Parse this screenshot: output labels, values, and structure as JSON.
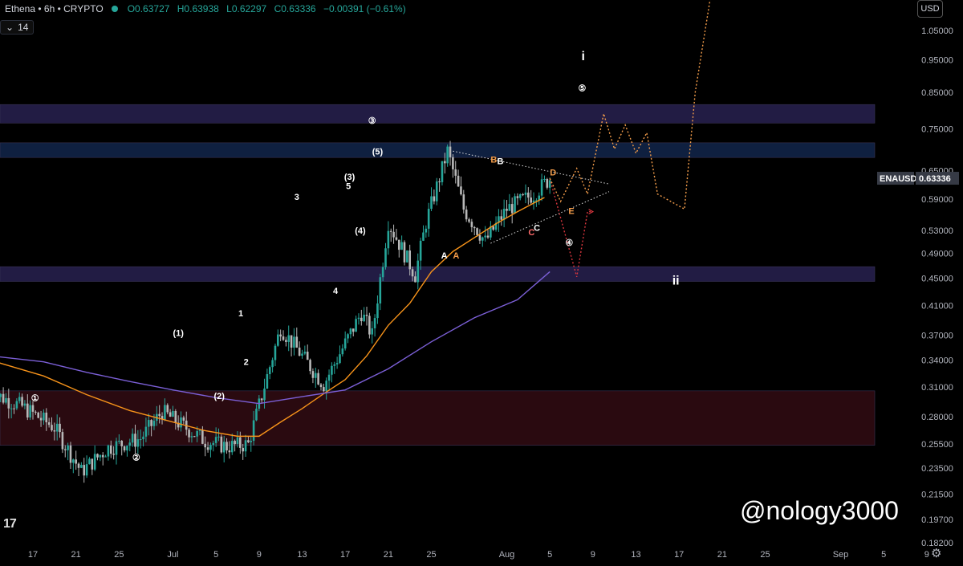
{
  "header": {
    "symbol": "Ethena • 6h • CRYPTO",
    "open": "O0.63727",
    "high": "H0.63938",
    "low": "L0.62297",
    "close": "C0.63336",
    "change": "−0.00391 (−0.61%)"
  },
  "indicator_toggle": "14",
  "currency": "USD",
  "watermark": "@nology3000",
  "tv_logo": "17",
  "settings_icon": "gear-icon",
  "price_badge": {
    "symbol": "ENAUSD",
    "value": "0.63336"
  },
  "colors": {
    "background": "#000000",
    "up_candle": "#26a69a",
    "down_candle": "#b8b8b8",
    "ma_short": "#f7931a",
    "ma_long": "#7b5fd6",
    "zone_purple": "#221c44",
    "zone_blue": "#0f2040",
    "zone_red": "#2a0a10",
    "projection_red": "#d9363e",
    "projection_orange": "#f39c4a"
  },
  "chart_data": {
    "type": "candlestick",
    "interval": "6h",
    "y_axis": {
      "scale": "log",
      "ticks": [
        1.05,
        0.95,
        0.85,
        0.75,
        0.65,
        0.59,
        0.53,
        0.49,
        0.45,
        0.41,
        0.37,
        0.34,
        0.31,
        0.28,
        0.255,
        0.235,
        0.215,
        0.197,
        0.182
      ],
      "tick_labels": [
        "1.05000",
        "0.95000",
        "0.85000",
        "0.75000",
        "0.65000",
        "0.59000",
        "0.53000",
        "0.49000",
        "0.45000",
        "0.41000",
        "0.37000",
        "0.34000",
        "0.31000",
        "0.28000",
        "0.25500",
        "0.23500",
        "0.21500",
        "0.19700",
        "0.18200"
      ]
    },
    "x_axis": {
      "tick_labels": [
        "17",
        "21",
        "25",
        "Jul",
        "5",
        "9",
        "13",
        "17",
        "21",
        "25",
        "Aug",
        "5",
        "9",
        "13",
        "17",
        "21",
        "25",
        "Sep",
        "5",
        "9"
      ],
      "tick_days": [
        17,
        21,
        25,
        30,
        34,
        38,
        42,
        46,
        50,
        54,
        61,
        65,
        69,
        73,
        77,
        81,
        85,
        92,
        96,
        100
      ],
      "day_reference": "June 1 = day 0"
    },
    "zones": [
      {
        "name": "resistance-purple",
        "from": 0.765,
        "to": 0.815,
        "color": "#221c44"
      },
      {
        "name": "resistance-blue",
        "from": 0.68,
        "to": 0.715,
        "color": "#0f2040"
      },
      {
        "name": "support-purple",
        "from": 0.445,
        "to": 0.468,
        "color": "#221c44"
      },
      {
        "name": "demand-red",
        "from": 0.254,
        "to": 0.306,
        "color": "#2a0a10"
      }
    ],
    "price_path": {
      "x": [
        13,
        16,
        19,
        21.5,
        24,
        27,
        29,
        31,
        33,
        35,
        37,
        40,
        44,
        47.5,
        48.5,
        50,
        52.5,
        53.5,
        55.5,
        57,
        59,
        61,
        63.5,
        65
      ],
      "y": [
        0.305,
        0.29,
        0.27,
        0.232,
        0.252,
        0.26,
        0.285,
        0.271,
        0.258,
        0.253,
        0.255,
        0.38,
        0.313,
        0.4,
        0.37,
        0.545,
        0.455,
        0.545,
        0.695,
        0.57,
        0.51,
        0.57,
        0.6,
        0.633
      ]
    },
    "moving_averages": [
      {
        "name": "ma-short",
        "color": "#f7931a",
        "x": [
          13,
          18,
          22,
          26,
          30,
          33,
          36,
          38,
          40,
          42,
          44,
          46,
          48,
          50,
          52,
          54,
          56,
          58,
          60,
          62,
          64.5
        ],
        "y": [
          0.34,
          0.322,
          0.302,
          0.286,
          0.275,
          0.267,
          0.262,
          0.262,
          0.275,
          0.288,
          0.303,
          0.318,
          0.345,
          0.383,
          0.413,
          0.46,
          0.493,
          0.517,
          0.542,
          0.565,
          0.593
        ]
      },
      {
        "name": "ma-long",
        "color": "#7b5fd6",
        "x": [
          13,
          18,
          22,
          26,
          30,
          34,
          38,
          42,
          46,
          50,
          54,
          58,
          62,
          65
        ],
        "y": [
          0.345,
          0.338,
          0.326,
          0.316,
          0.307,
          0.299,
          0.293,
          0.3,
          0.307,
          0.33,
          0.362,
          0.393,
          0.418,
          0.46
        ]
      }
    ],
    "trendlines": [
      {
        "name": "triangle-upper",
        "x": [
          56,
          70.5
        ],
        "y": [
          0.695,
          0.621
        ]
      },
      {
        "name": "triangle-lower",
        "x": [
          59.5,
          70.5
        ],
        "y": [
          0.507,
          0.605
        ]
      }
    ],
    "projections": [
      {
        "name": "projection-red",
        "color": "#d9363e",
        "x": [
          65,
          67.5,
          68.5,
          69
        ],
        "y": [
          0.633,
          0.452,
          0.565,
          0.565
        ]
      },
      {
        "name": "projection-orange",
        "color": "#f39c4a",
        "x": [
          65,
          66,
          67.5,
          68.5,
          70,
          71,
          72,
          73,
          74,
          75,
          77.5,
          78.5,
          80,
          81.5
        ],
        "y": [
          0.633,
          0.585,
          0.655,
          0.6,
          0.79,
          0.7,
          0.76,
          0.69,
          0.74,
          0.6,
          0.57,
          0.85,
          1.2,
          1.4
        ]
      }
    ],
    "wave_labels": [
      {
        "text": "①",
        "x": 17.2,
        "y": 0.298,
        "color": "#ffffff"
      },
      {
        "text": "②",
        "x": 26.6,
        "y": 0.243,
        "color": "#ffffff"
      },
      {
        "text": "③",
        "x": 48.5,
        "y": 0.77,
        "color": "#ffffff"
      },
      {
        "text": "④",
        "x": 66.8,
        "y": 0.507,
        "color": "#ffffff"
      },
      {
        "text": "⑤",
        "x": 68,
        "y": 0.86,
        "color": "#ffffff"
      },
      {
        "text": "(1)",
        "x": 30.5,
        "y": 0.372,
        "color": "#ffffff"
      },
      {
        "text": "(2)",
        "x": 34.3,
        "y": 0.3,
        "color": "#ffffff"
      },
      {
        "text": "(3)",
        "x": 46.4,
        "y": 0.635,
        "color": "#ffffff"
      },
      {
        "text": "(4)",
        "x": 47.4,
        "y": 0.528,
        "color": "#ffffff"
      },
      {
        "text": "(5)",
        "x": 49,
        "y": 0.692,
        "color": "#ffffff"
      },
      {
        "text": "1",
        "x": 36.3,
        "y": 0.398,
        "color": "#ffffff"
      },
      {
        "text": "2",
        "x": 36.8,
        "y": 0.337,
        "color": "#ffffff"
      },
      {
        "text": "3",
        "x": 41.5,
        "y": 0.593,
        "color": "#ffffff"
      },
      {
        "text": "4",
        "x": 45.1,
        "y": 0.43,
        "color": "#ffffff"
      },
      {
        "text": "5",
        "x": 46.3,
        "y": 0.615,
        "color": "#ffffff"
      },
      {
        "text": "A",
        "x": 55.2,
        "y": 0.485,
        "color": "#ffffff"
      },
      {
        "text": "A",
        "x": 56.3,
        "y": 0.485,
        "color": "#f39c4a"
      },
      {
        "text": "B",
        "x": 59.8,
        "y": 0.674,
        "color": "#f39c4a"
      },
      {
        "text": "B",
        "x": 60.4,
        "y": 0.67,
        "color": "#ffffff"
      },
      {
        "text": "C",
        "x": 63.3,
        "y": 0.525,
        "color": "#ff6b6b"
      },
      {
        "text": "C",
        "x": 63.8,
        "y": 0.533,
        "color": "#ffffff"
      },
      {
        "text": "D",
        "x": 65.3,
        "y": 0.645,
        "color": "#f39c4a"
      },
      {
        "text": "E",
        "x": 67,
        "y": 0.565,
        "color": "#f39c4a"
      },
      {
        "text": "i",
        "x": 68.1,
        "y": 0.96,
        "color": "#ffffff"
      },
      {
        "text": "ii",
        "x": 76.7,
        "y": 0.445,
        "color": "#ffffff"
      }
    ]
  }
}
